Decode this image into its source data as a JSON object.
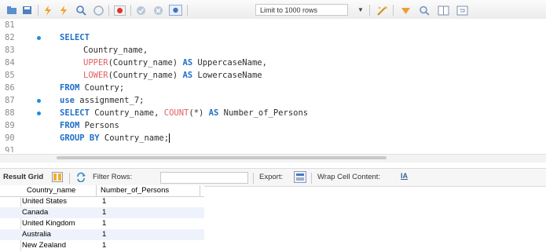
{
  "toolbar": {
    "limit_label": "Limit to 1000 rows",
    "icons": [
      "folder-icon",
      "save-icon",
      "lightning-icon",
      "lightning-cursor-icon",
      "magnifier-icon",
      "stop-icon",
      "error-icon",
      "check-icon",
      "cancel-icon",
      "toggle-icon",
      "beautify-icon",
      "bookmark-icon",
      "search-icon",
      "columns-icon",
      "wrap-icon"
    ]
  },
  "editor": {
    "lines": [
      {
        "num": "81",
        "dot": false
      },
      {
        "num": "82",
        "dot": true
      },
      {
        "num": "83",
        "dot": false
      },
      {
        "num": "84",
        "dot": false
      },
      {
        "num": "85",
        "dot": false
      },
      {
        "num": "86",
        "dot": false
      },
      {
        "num": "87",
        "dot": true
      },
      {
        "num": "88",
        "dot": true
      },
      {
        "num": "89",
        "dot": false
      },
      {
        "num": "90",
        "dot": false
      },
      {
        "num": "91",
        "dot": false
      }
    ],
    "code": {
      "l82_kw": "SELECT",
      "l83": "Country_name,",
      "l84_fn": "UPPER",
      "l84_rest": "(Country_name) ",
      "l84_as": "AS",
      "l84_alias": " UppercaseName,",
      "l85_fn": "LOWER",
      "l85_rest": "(Country_name) ",
      "l85_as": "AS",
      "l85_alias": " LowercaseName",
      "l86_kw": "FROM",
      "l86_rest": " Country;",
      "l87_kw": "use",
      "l87_rest": " assignment_7;",
      "l88_kw": "SELECT",
      "l88_a": " Country_name, ",
      "l88_fn": "COUNT",
      "l88_b": "(*) ",
      "l88_as": "AS",
      "l88_c": " Number_of_Persons",
      "l89_kw": "FROM",
      "l89_rest": " Persons",
      "l90_kw": "GROUP BY",
      "l90_rest": " Country_name;"
    }
  },
  "result_toolbar": {
    "result_grid": "Result Grid",
    "filter_rows": "Filter Rows:",
    "export": "Export:",
    "wrap": "Wrap Cell Content:"
  },
  "grid": {
    "columns": [
      "Country_name",
      "Number_of_Persons"
    ],
    "rows": [
      [
        "United States",
        "1"
      ],
      [
        "Canada",
        "1"
      ],
      [
        "United Kingdom",
        "1"
      ],
      [
        "Australia",
        "1"
      ],
      [
        "New Zealand",
        "1"
      ]
    ]
  }
}
